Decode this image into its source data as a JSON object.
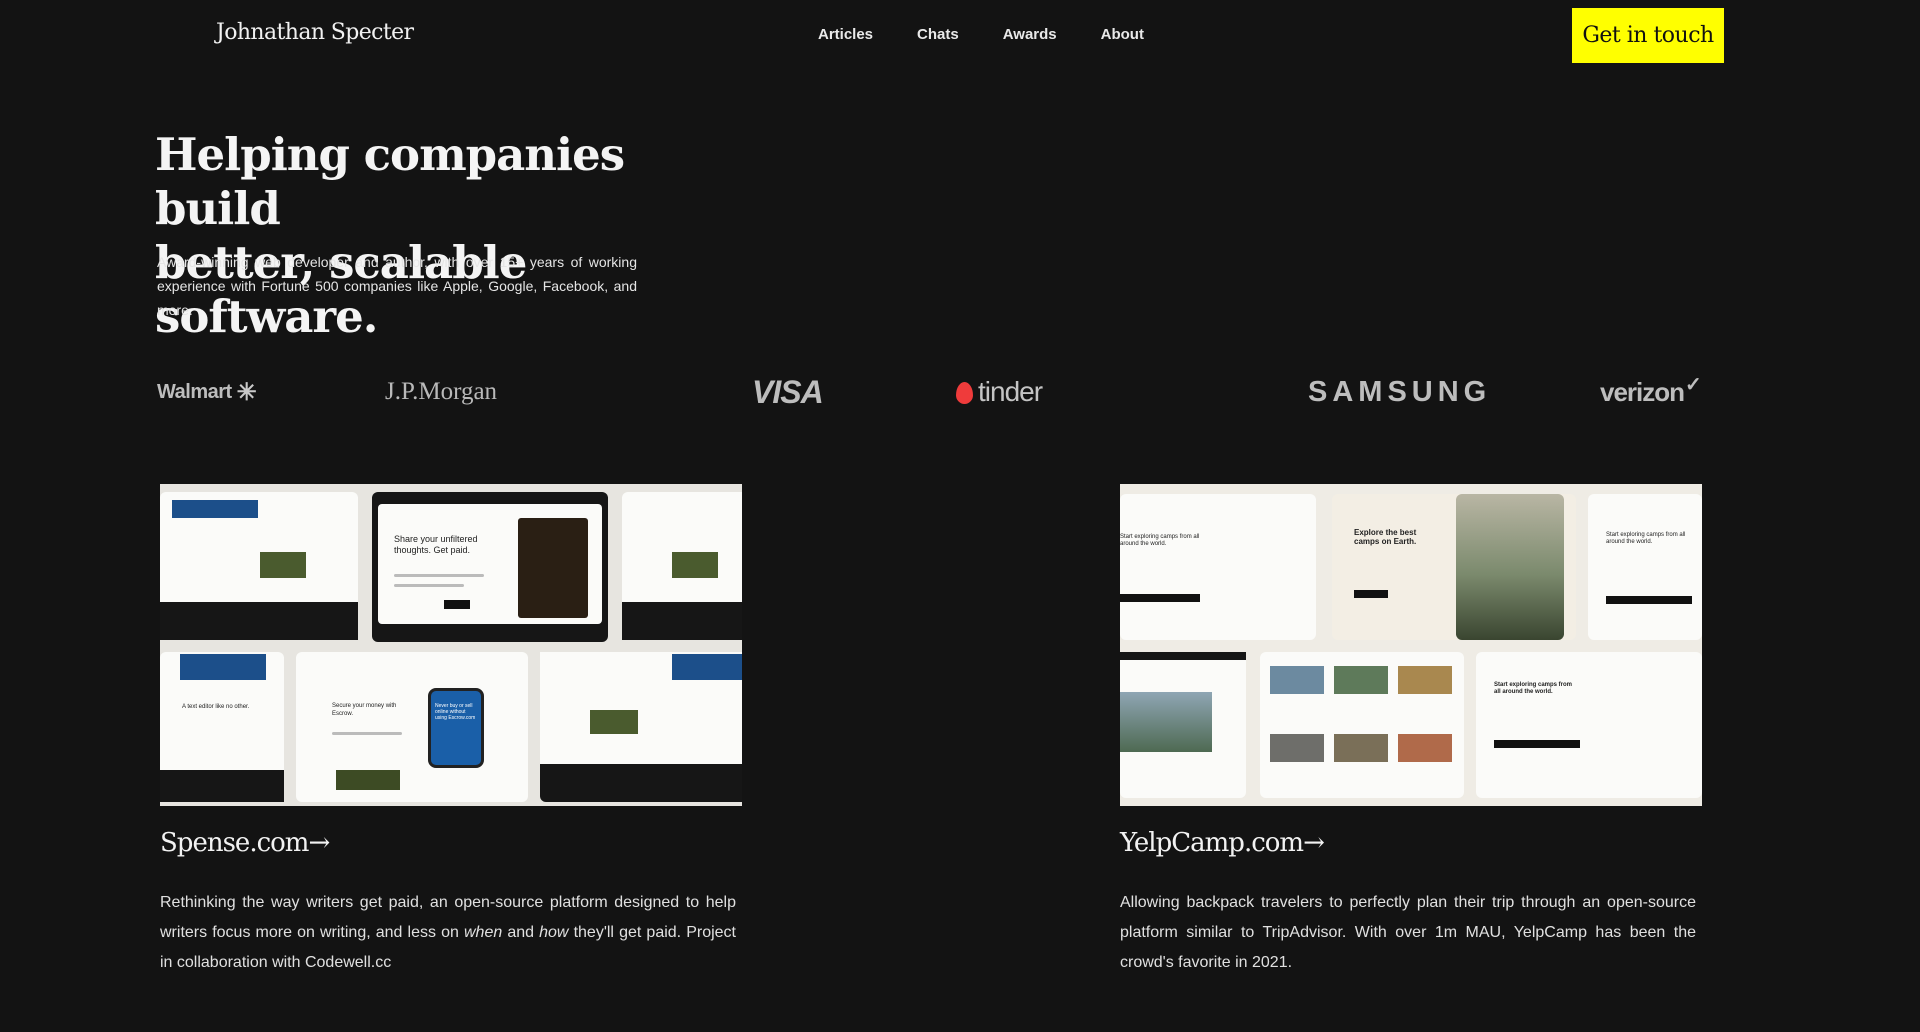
{
  "header": {
    "brand": "Johnathan Specter",
    "nav": [
      "Articles",
      "Chats",
      "Awards",
      "About"
    ],
    "cta_label": "Get in touch",
    "cta_color": "#ffff00"
  },
  "hero": {
    "title_line1": "Helping companies build",
    "title_line2": "better, scalable software.",
    "subtitle": "Award-winning web developer and author, with over 15+ years of working experience with Fortune 500 companies like Apple, Google, Facebook, and more."
  },
  "logos": {
    "walmart": "Walmart",
    "jpmorgan": "J.P.Morgan",
    "visa": "VISA",
    "tinder": "tinder",
    "samsung": "SAMSUNG",
    "verizon": "verizon"
  },
  "projects": [
    {
      "title": "Spense.com",
      "arrow": "→",
      "desc_part1": "Rethinking the way writers get paid, an open-source platform designed to help writers focus more on writing, and less on ",
      "desc_em1": "when",
      "desc_part2": " and ",
      "desc_em2": "how",
      "desc_part3": " they'll get paid. Project in collaboration with Codewell.cc",
      "mockup": {
        "headline": "Share your unfiltered thoughts. Get paid.",
        "phone_text": "Never buy or sell online without using Escrow.com",
        "editor_text": "A text editor like no other.",
        "money_text": "Secure your money with Escrow."
      }
    },
    {
      "title": "YelpCamp.com",
      "arrow": "→",
      "desc": "Allowing backpack travelers to perfectly plan their trip through an open-source platform similar to TripAdvisor. With over 1m MAU, YelpCamp has been the crowd's favorite in 2021.",
      "mockup": {
        "headline": "Explore the best camps on Earth.",
        "signin": "Start exploring camps from all around the world."
      }
    }
  ]
}
